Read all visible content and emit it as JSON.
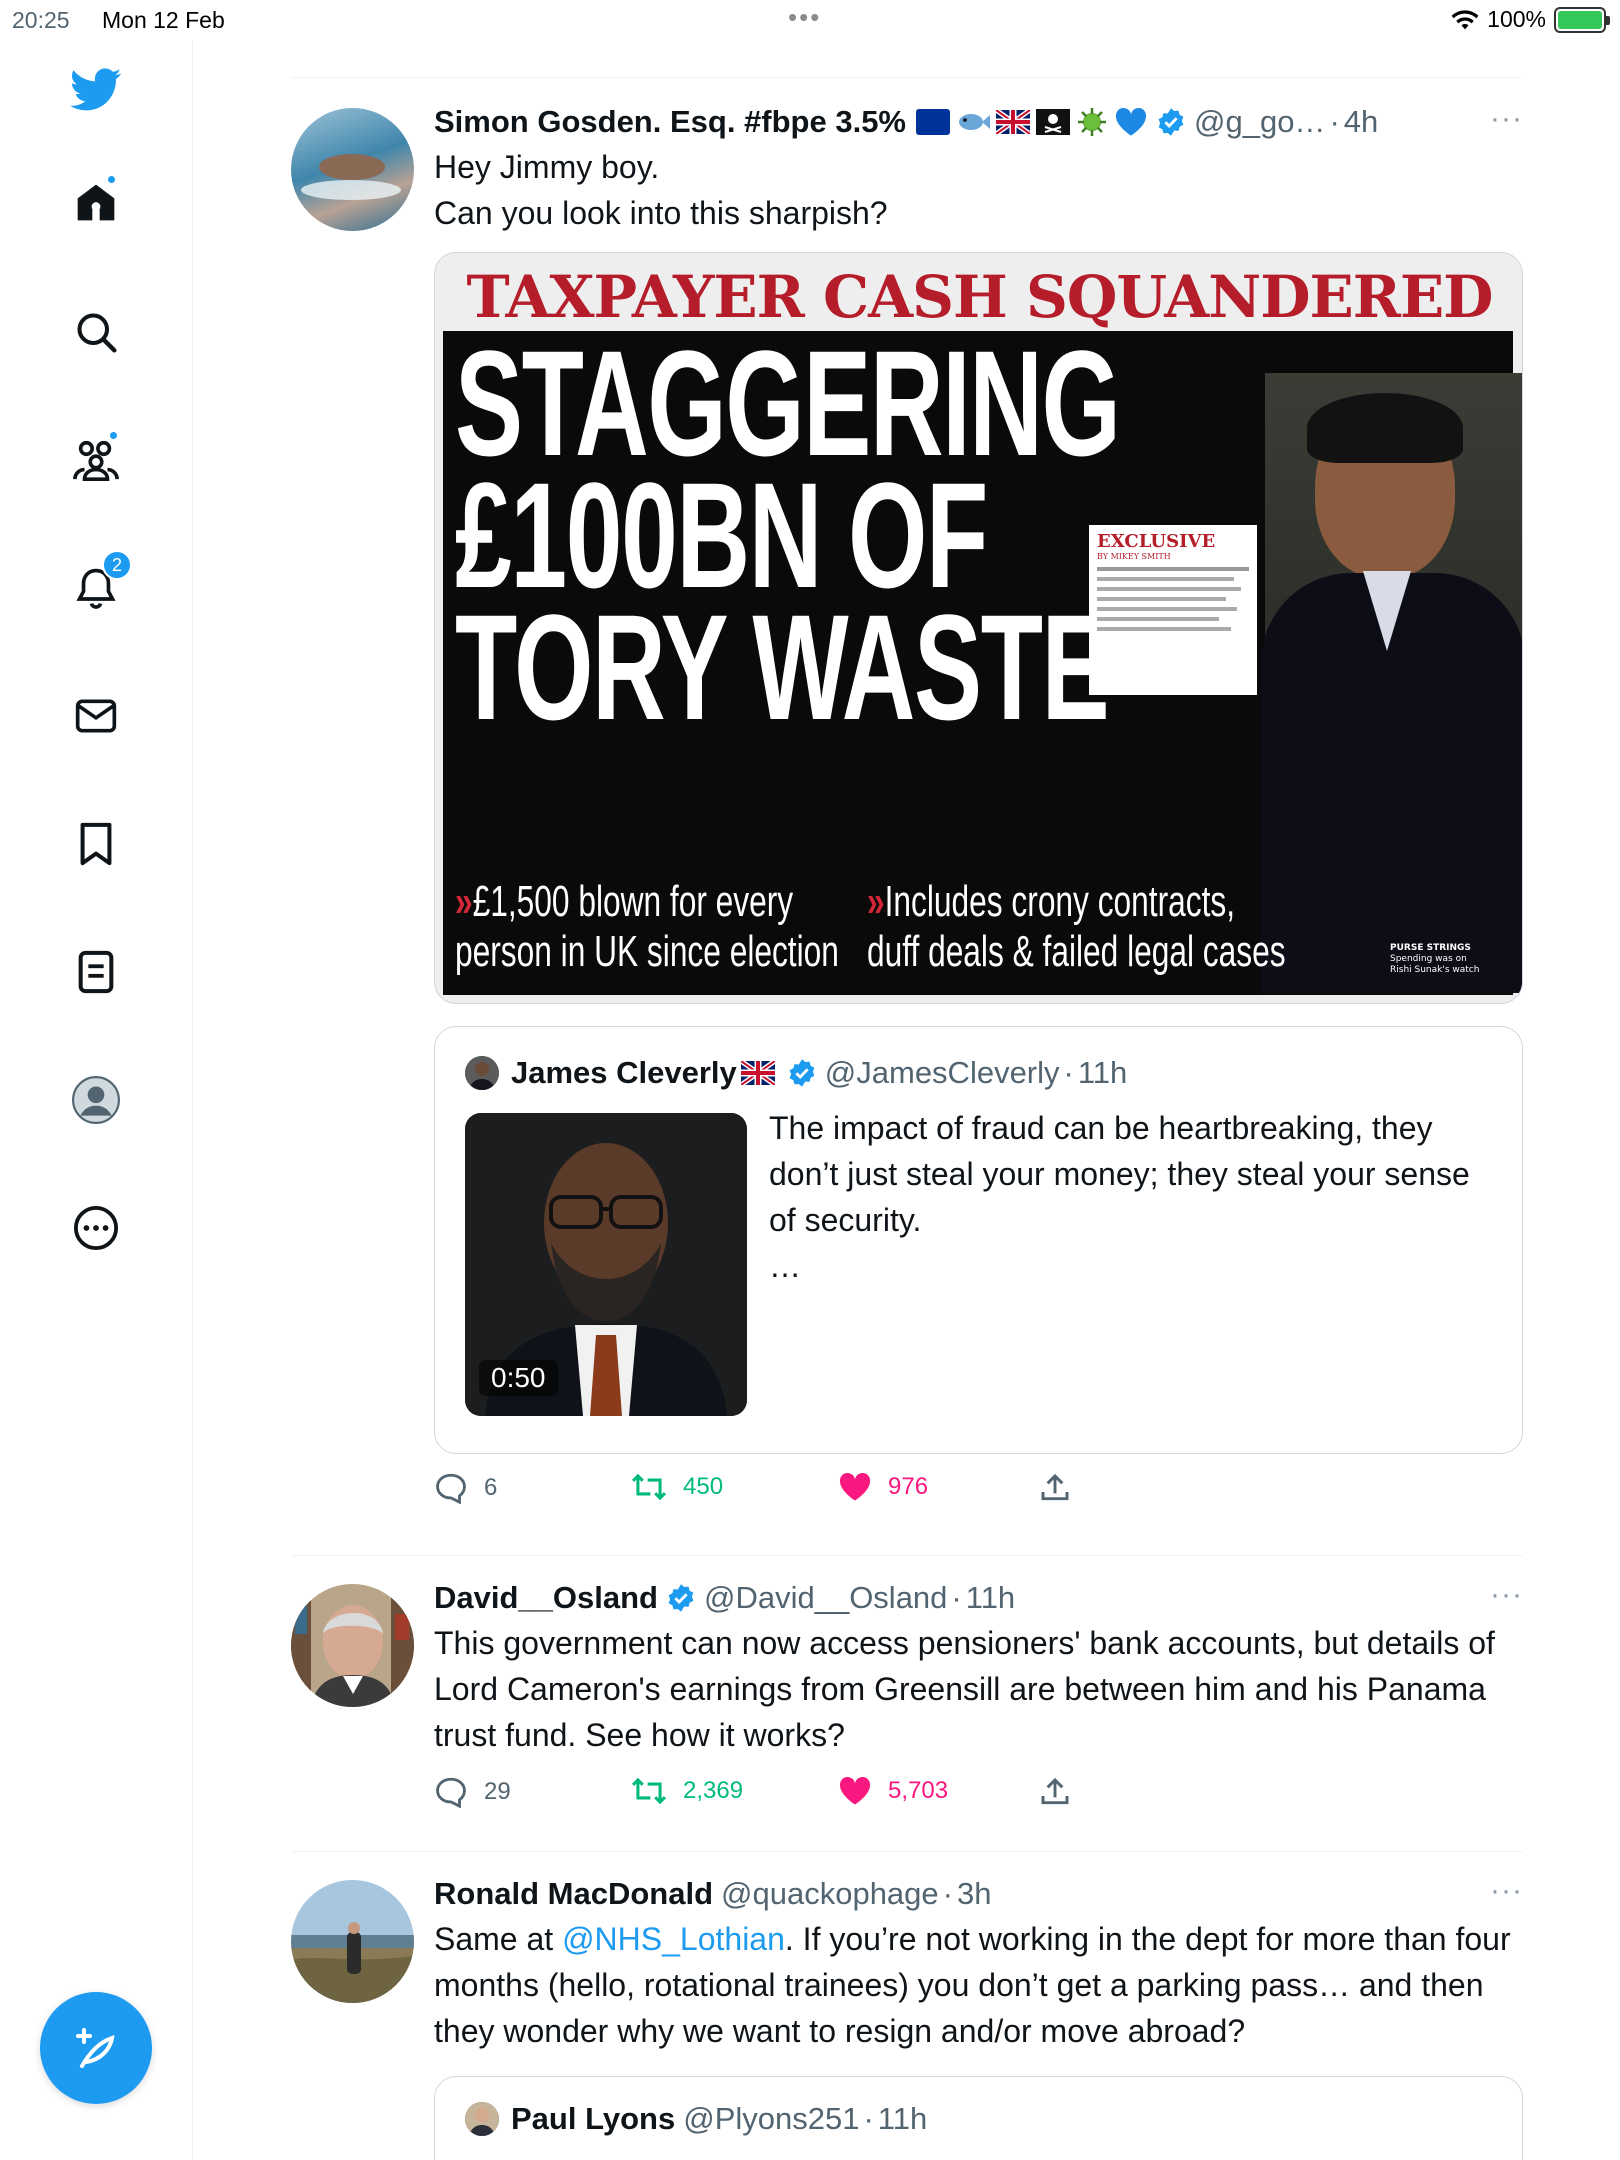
{
  "status_bar": {
    "time": "20:25",
    "date": "Mon 12 Feb",
    "battery": "100%"
  },
  "sidebar": {
    "notifications_badge": "2",
    "items": [
      "twitter-logo",
      "home-icon",
      "search-icon",
      "communities-icon",
      "notifications-icon",
      "messages-icon",
      "bookmarks-icon",
      "lists-icon",
      "profile-icon",
      "more-icon"
    ]
  },
  "colors": {
    "accent": "#1d9bf0",
    "retweet": "#00ba7c",
    "like": "#f91880",
    "secondary_text": "#536471"
  },
  "tweets": [
    {
      "name": "Simon Gosden. Esq. #fbpe 3.5%",
      "handle": "@g_go…",
      "time": "4h",
      "text_line1": "Hey Jimmy boy.",
      "text_line2": "Can you look into this sharpish?",
      "media": {
        "kicker": "TAXPAYER CASH SQUANDERED",
        "headline1": "STAGGERING",
        "headline2": "£100BN OF",
        "headline3": "TORY WASTE",
        "exclusive": "EXCLUSIVE",
        "byline": "BY MIKEY SMITH",
        "sub1a": "£1,500 blown for every",
        "sub1b": "person in UK since election",
        "sub2a": "Includes crony contracts,",
        "sub2b": "duff deals & failed legal cases",
        "caption1": "PURSE STRINGS",
        "caption2": "Spending was on",
        "caption3": "Rishi Sunak's watch"
      },
      "quote": {
        "name": "James Cleverly",
        "handle": "@JamesCleverly",
        "time": "11h",
        "text": "The impact of fraud can be heartbreaking, they don’t just steal your money; they steal your sense of security.",
        "ellipsis": "…",
        "duration": "0:50"
      },
      "replies": "6",
      "retweets": "450",
      "likes": "976"
    },
    {
      "name": "David__Osland",
      "handle": "@David__Osland",
      "time": "11h",
      "text": "This government can now access pensioners' bank accounts, but details of Lord Cameron's earnings from Greensill are between him and his Panama trust fund. See how it works?",
      "replies": "29",
      "retweets": "2,369",
      "likes": "5,703"
    },
    {
      "name": "Ronald MacDonald",
      "handle": "@quackophage",
      "time": "3h",
      "text_before": "Same at ",
      "mention": "@NHS_Lothian",
      "text_after": ". If you’re not working in the dept for more than four months (hello, rotational trainees) you don’t get a parking pass… and then they wonder why we want to resign and/or move abroad?",
      "quote": {
        "name": "Paul Lyons",
        "handle": "@Plyons251",
        "time": "11h"
      }
    }
  ],
  "separator": "·",
  "more_glyph": "···"
}
